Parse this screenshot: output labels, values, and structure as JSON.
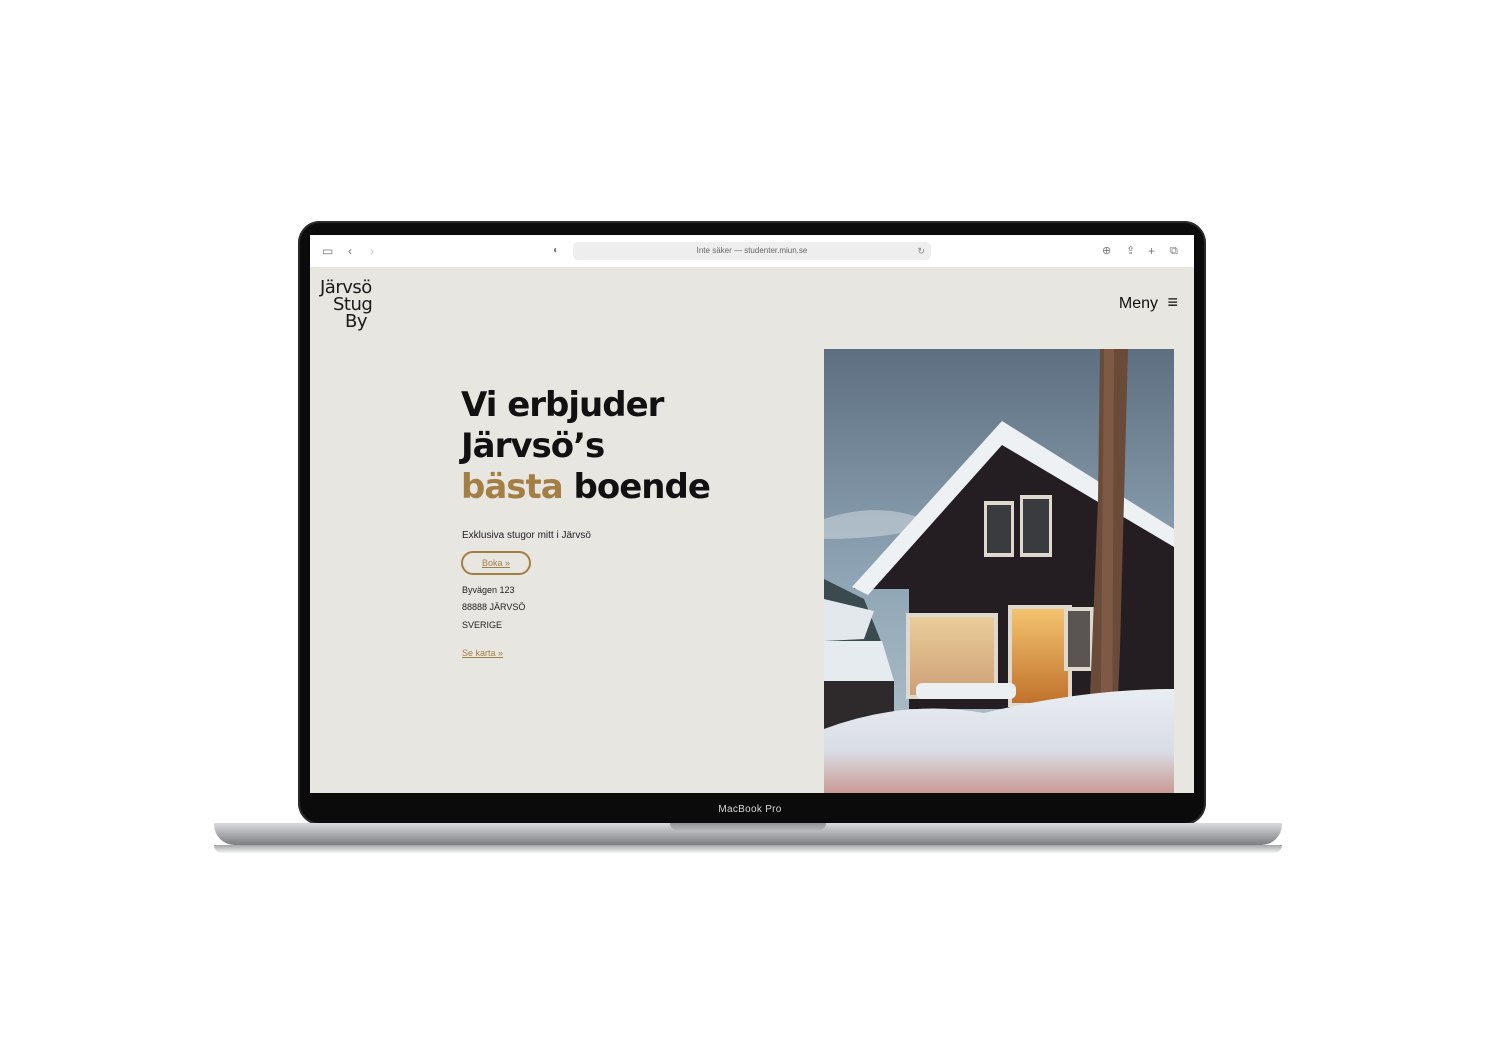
{
  "device": {
    "label": "MacBook Pro"
  },
  "browser": {
    "url_text": "Inte säker — studenter.miun.se",
    "icons": [
      "sidebar-icon",
      "back-icon",
      "forward-icon",
      "shield-icon",
      "reload-icon",
      "download-icon",
      "share-icon",
      "new-tab-icon",
      "tabs-icon"
    ]
  },
  "site": {
    "logo": {
      "line1": "Järvsö",
      "line2": "Stug",
      "line3": "By"
    },
    "menu_label": "Meny",
    "hero": {
      "line1": "Vi erbjuder",
      "line2": "Järvsö’s",
      "line3_accent": "bästa",
      "line3_rest": " boende",
      "subtitle": "Exklusiva stugor mitt i Järvsö",
      "book_label": "Boka »",
      "address": [
        "Byvägen 123",
        "88888 JÄRVSÖ",
        "SVERIGE"
      ],
      "map_link": "Se karta »"
    },
    "colors": {
      "accent": "#a47f45",
      "background": "#e8e6e1",
      "text": "#111111"
    }
  }
}
